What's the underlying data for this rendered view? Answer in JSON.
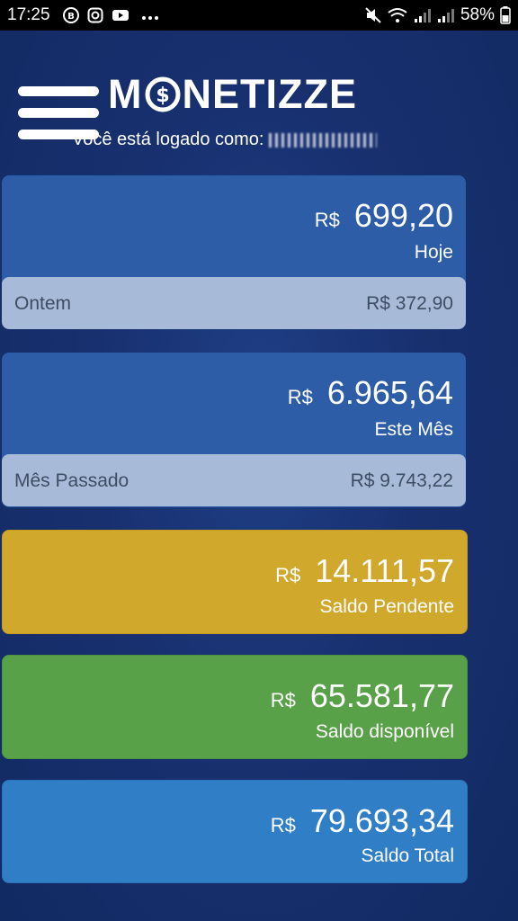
{
  "status_bar": {
    "time": "17:25",
    "battery": "58%",
    "left_icons": [
      "b-circle-icon",
      "instagram-icon",
      "youtube-icon",
      "more-dots-icon"
    ],
    "right_icons": [
      "mute-icon",
      "wifi-icon",
      "signal-icon",
      "signal-icon-2",
      "battery-icon"
    ]
  },
  "header": {
    "logo_left": "M",
    "logo_right": "NETIZZE",
    "logged_in_label": "Você está logado como:"
  },
  "cards": {
    "today": {
      "currency": "R$",
      "amount": "699,20",
      "caption": "Hoje",
      "secondary_label": "Ontem",
      "secondary_value": "R$ 372,90"
    },
    "month": {
      "currency": "R$",
      "amount": "6.965,64",
      "caption": "Este Mês",
      "secondary_label": "Mês Passado",
      "secondary_value": "R$ 9.743,22"
    },
    "pending": {
      "currency": "R$",
      "amount": "14.111,57",
      "caption": "Saldo Pendente"
    },
    "available": {
      "currency": "R$",
      "amount": "65.581,77",
      "caption": "Saldo disponível"
    },
    "total": {
      "currency": "R$",
      "amount": "79.693,34",
      "caption": "Saldo Total"
    }
  },
  "colors": {
    "background": "#18306f",
    "card_blue": "#2c5da6",
    "card_secondary": "#a7bad8",
    "pending": "#d0a82c",
    "available": "#59a148",
    "total": "#2f7ec6"
  }
}
